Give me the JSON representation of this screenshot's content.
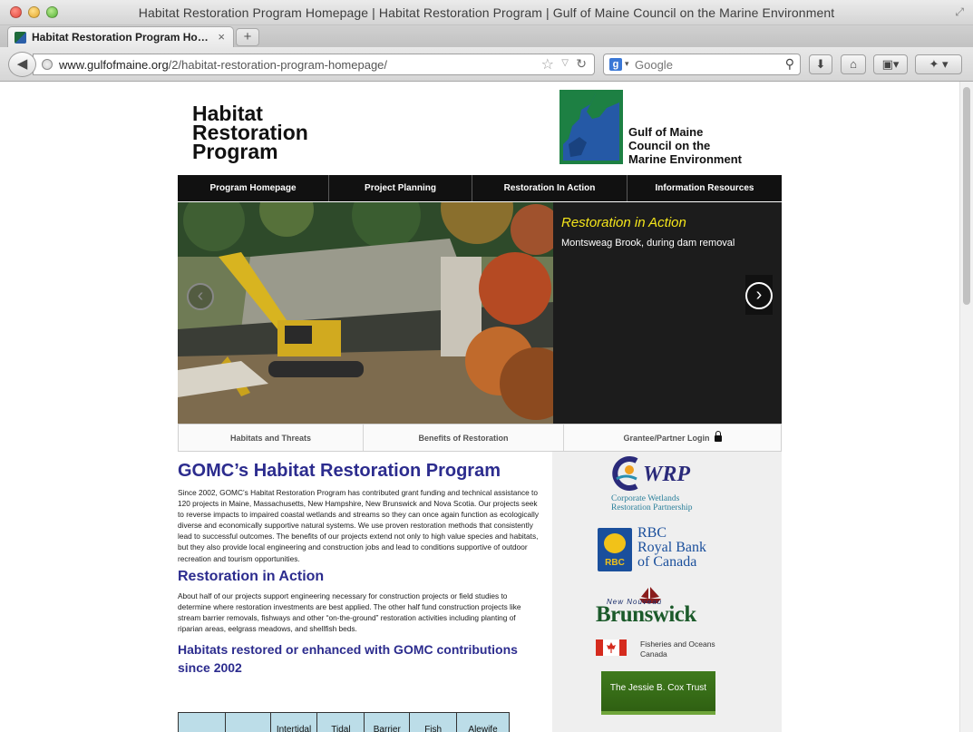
{
  "browser": {
    "window_title": "Habitat Restoration Program Homepage | Habitat Restoration Program | Gulf of Maine Council on the Marine Environment",
    "tab_title": "Habitat Restoration Program Ho…",
    "url_domain": "www.gulfofmaine.org",
    "url_path": "/2/habitat-restoration-program-homepage/",
    "search_placeholder": "Google",
    "search_engine": "Google"
  },
  "site": {
    "logo_title": [
      "Habitat",
      "Restoration",
      "Program"
    ],
    "org_name": [
      "Gulf of Maine",
      "Council on the",
      "Marine Environment"
    ],
    "brand_colors": {
      "nav_bg": "#111111",
      "heading_blue": "#2c2c8e",
      "caption_yellow": "#f5e61b",
      "table_head": "#bcdde8"
    }
  },
  "nav": {
    "items": [
      "Program Homepage",
      "Project Planning",
      "Restoration In Action",
      "Information Resources"
    ]
  },
  "slider": {
    "title": "Restoration in Action",
    "caption": "Montsweag Brook, during dam removal",
    "prev_icon": "‹",
    "next_icon": "›"
  },
  "subnav": {
    "items": [
      "Habitats and Threats",
      "Benefits of Restoration",
      "Grantee/Partner Login"
    ]
  },
  "content": {
    "heading": "GOMC’s Habitat Restoration Program",
    "intro": "Since 2002, GOMC’s Habitat Restoration Program has contributed grant funding and technical assistance to 120 projects in Maine, Massachusetts, New Hampshire, New Brunswick and Nova Scotia. Our projects seek to reverse impacts to impaired coastal wetlands and streams so they can once again function as ecologically diverse and economically supportive natural systems. We use proven restoration methods that consistently lead to successful outcomes. The benefits of our projects extend not only to high value species and habitats, but they also provide local engineering and construction jobs and lead to conditions supportive of outdoor recreation and tourism opportunities.",
    "section2_heading": "Restoration in Action",
    "section2_text": "About half of our projects support engineering necessary for construction projects or field studies to determine where restoration investments are best applied. The other half fund construction projects like stream barrier removals, fishways and other “on-the-ground” restoration activities including planting of riparian areas, eelgrass meadows, and shellfish beds.",
    "section3_heading": "Habitats restored or enhanced with GOMC contributions since 2002",
    "table_headers": [
      "",
      "",
      "Intertidal",
      "Tidal",
      "Barrier",
      "Fish",
      "Alewife"
    ]
  },
  "sponsors": {
    "cwrp_letters": "WRP",
    "cwrp_name": [
      "Corporate Wetlands",
      "Restoration Partnership"
    ],
    "rbc_badge": "RBC",
    "rbc_name": [
      "RBC",
      "Royal Bank",
      "of Canada"
    ],
    "nb_small": "New Nouveau",
    "nb_name": "Brunswick",
    "dfo_name": [
      "Fisheries and Oceans",
      "Canada"
    ],
    "cox_name": "The Jessie B. Cox Trust"
  }
}
